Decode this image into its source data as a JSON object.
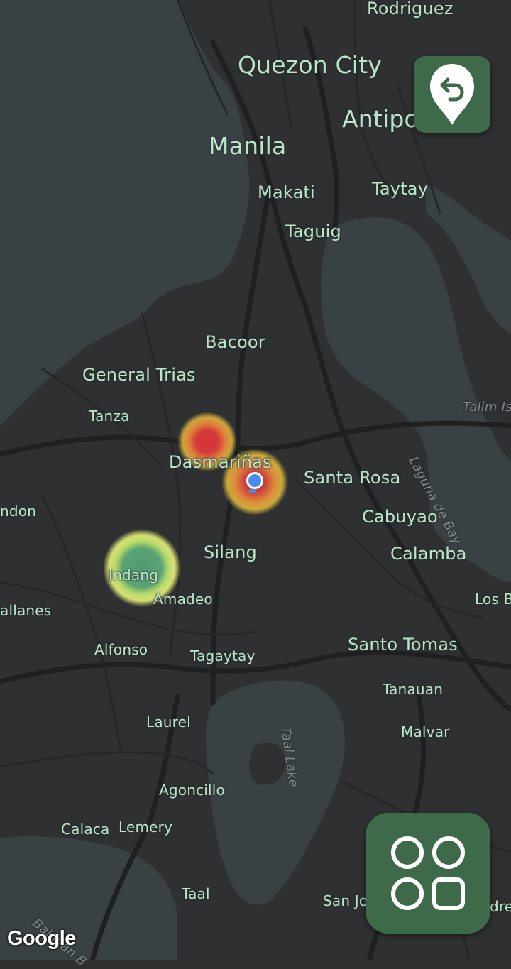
{
  "map": {
    "theme": "dark",
    "colors": {
      "land": "#2e3031",
      "water": "#3a4145",
      "road": "#232425",
      "label": "#b9e6c9",
      "accent": "#3e6a4a",
      "user_location": "#4a8af4"
    },
    "labels": {
      "rodriguez": "Rodriguez",
      "quezon_city": "Quezon City",
      "antipolo": "Antipo",
      "manila": "Manila",
      "makati": "Makati",
      "taytay": "Taytay",
      "taguig": "Taguig",
      "bacoor": "Bacoor",
      "general_trias": "General Trias",
      "tanza": "Tanza",
      "dasmarinas": "Dasmariñas",
      "santa_rosa": "Santa Rosa",
      "cabuyao": "Cabuyao",
      "calamba": "Calamba",
      "silang": "Silang",
      "indang": "Indang",
      "amadeo": "Amadeo",
      "naic": "ndon",
      "magallanes": "allanes",
      "alfonso": "Alfonso",
      "tagaytay": "Tagaytay",
      "santo_tomas": "Santo Tomas",
      "tanauan": "Tanauan",
      "malvar": "Malvar",
      "los_banos": "Los B",
      "laurel": "Laurel",
      "agoncillo": "Agoncillo",
      "calaca": "Calaca",
      "lemery": "Lemery",
      "taal": "Taal",
      "san_jose": "San Jo",
      "andres": "dre",
      "talim": "Talim Is",
      "laguna_de_bay": "Laguna de Bay",
      "taal_lake": "Taal Lake",
      "balayan_bay": "Balayan B"
    },
    "heat_spots": [
      {
        "name": "hotspot-dasmarinas-north",
        "level": "high",
        "color": "red"
      },
      {
        "name": "hotspot-dasmarinas-current",
        "level": "high",
        "color": "red"
      },
      {
        "name": "hotspot-indang",
        "level": "low",
        "color": "green"
      }
    ],
    "attribution": "Google"
  },
  "controls": {
    "recenter_button": {
      "icon": "location-return-icon"
    },
    "apps_button": {
      "icon": "apps-grid-icon"
    }
  }
}
